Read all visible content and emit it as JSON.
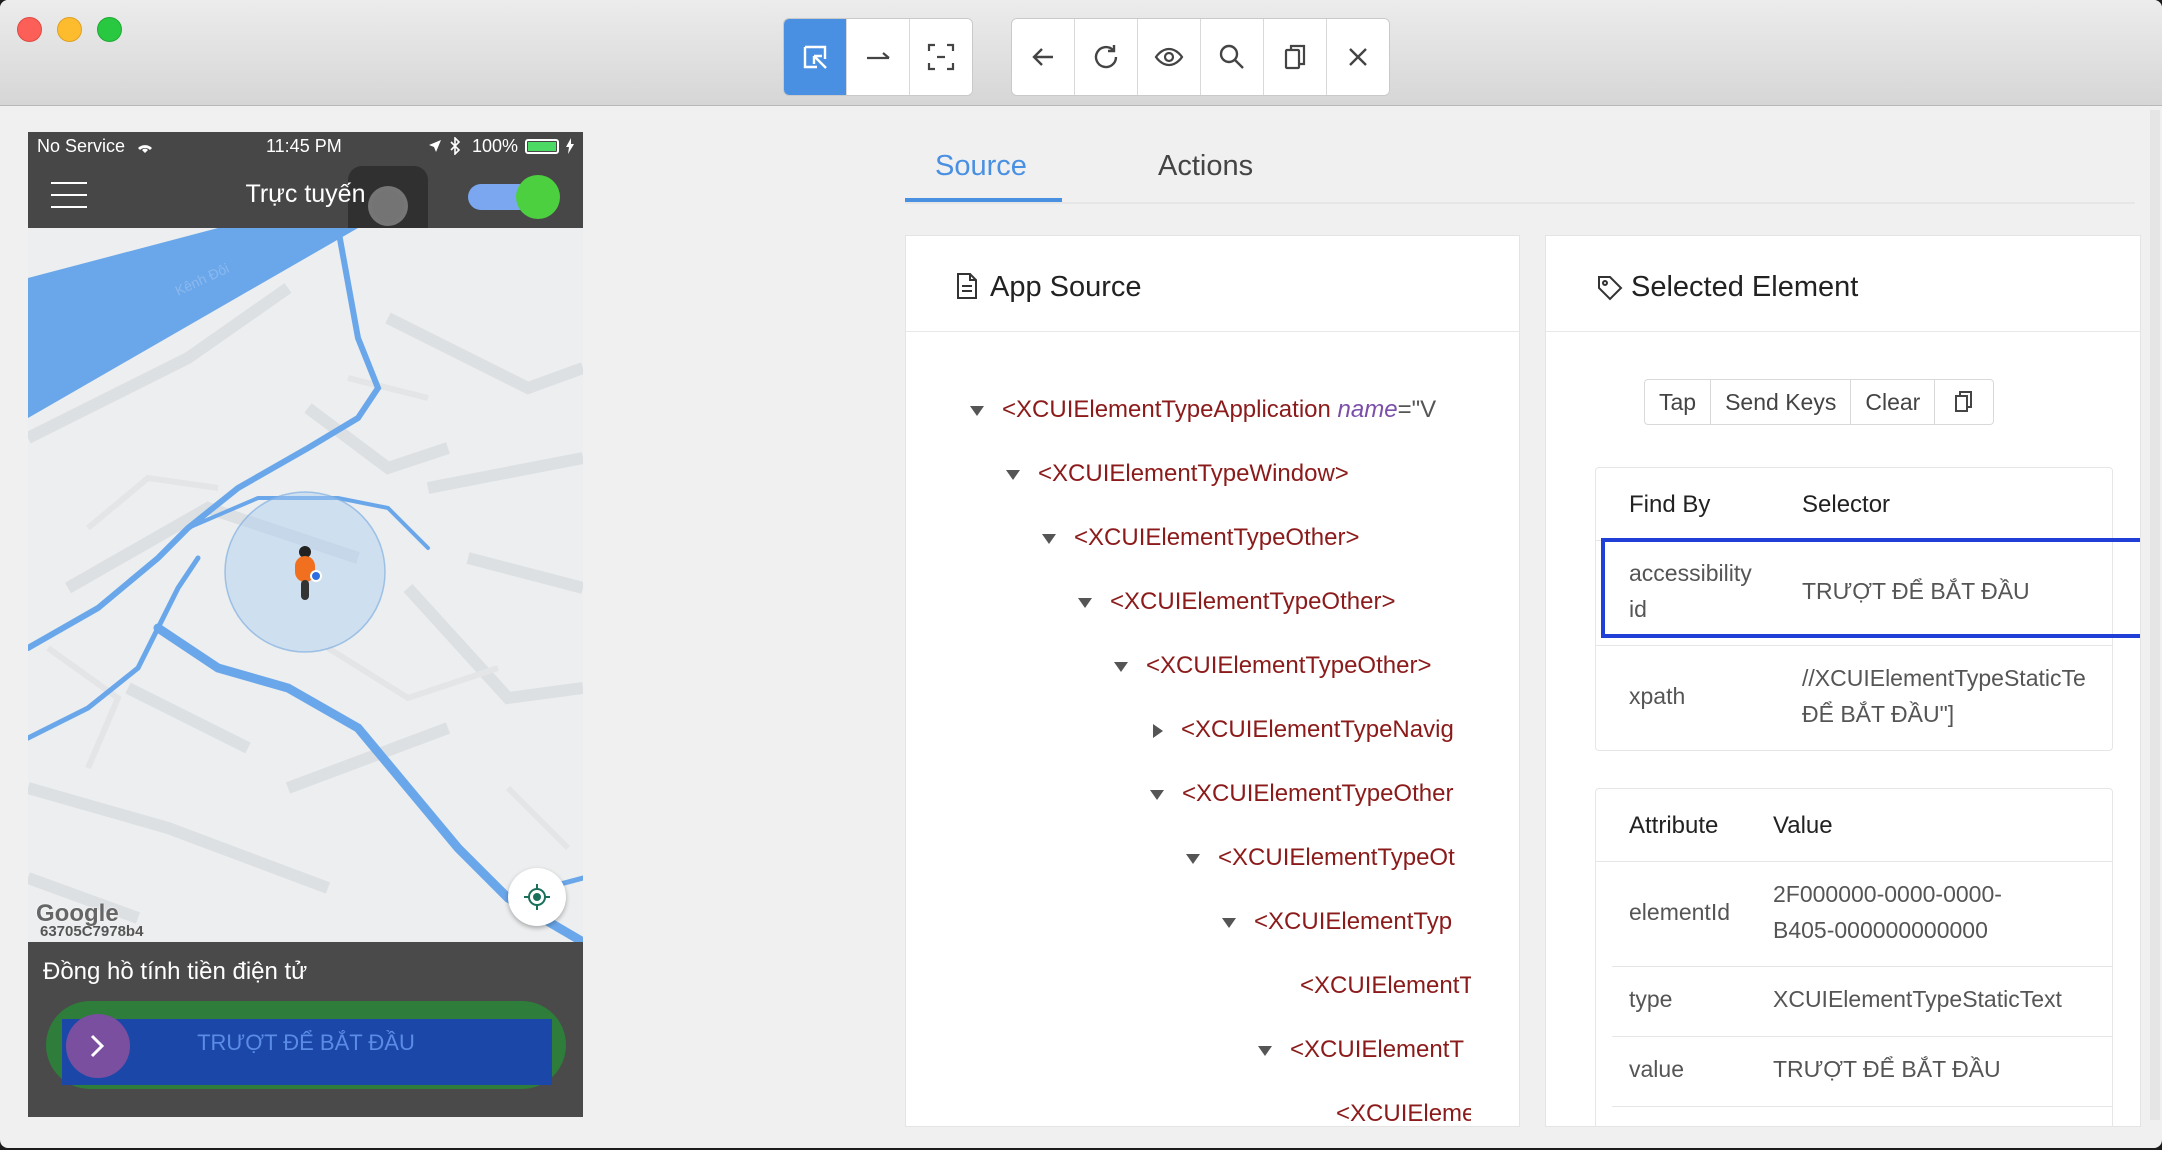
{
  "toolbar": {
    "icons": [
      "select-element-icon",
      "swipe-icon",
      "tap-coordinates-icon",
      "back-icon",
      "refresh-icon",
      "show-icon",
      "search-icon",
      "copy-icon",
      "close-icon"
    ]
  },
  "phone": {
    "status": {
      "carrier": "No Service",
      "time": "11:45 PM",
      "battery": "100%"
    },
    "nav_title": "Trực tuyến",
    "map_water_label": "Kênh Đôi",
    "google_label": "Google",
    "device_code": "63705C7978b4",
    "meter_label": "Đồng hồ tính tiền điện tử",
    "slide_label": "TRƯỢT ĐỂ BẮT ĐẦU"
  },
  "tabs": {
    "source": "Source",
    "actions": "Actions"
  },
  "app_source": {
    "title": "App Source",
    "nodes": [
      {
        "tag": "<XCUIElementTypeApplication",
        "attr": "name",
        "val": "=\"V"
      },
      {
        "tag": "<XCUIElementTypeWindow>"
      },
      {
        "tag": "<XCUIElementTypeOther>"
      },
      {
        "tag": "<XCUIElementTypeOther>"
      },
      {
        "tag": "<XCUIElementTypeOther>"
      },
      {
        "tag": "<XCUIElementTypeNavig"
      },
      {
        "tag": "<XCUIElementTypeOther"
      },
      {
        "tag": "<XCUIElementTypeOt"
      },
      {
        "tag": "<XCUIElementTyp"
      },
      {
        "tag": "<XCUIElementT"
      },
      {
        "tag": "<XCUIElementT"
      },
      {
        "tag": "<XCUIEleme"
      }
    ]
  },
  "selected": {
    "title": "Selected Element",
    "actions": [
      "Tap",
      "Send Keys",
      "Clear"
    ],
    "find_headers": [
      "Find By",
      "Selector"
    ],
    "find_rows": [
      {
        "by_1": "accessibility",
        "by_2": "id",
        "selector": "TRƯỢT ĐỂ BẮT ĐẦU"
      },
      {
        "by_1": "xpath",
        "by_2": "",
        "selector": "//XCUIElementTypeStaticTe",
        "selector_2": "ĐỂ BẮT ĐẦU\"]"
      }
    ],
    "attr_headers": [
      "Attribute",
      "Value"
    ],
    "attr_rows": [
      {
        "name": "elementId",
        "value": "2F000000-0000-0000-",
        "value_2": "B405-000000000000"
      },
      {
        "name": "type",
        "value": "XCUIElementTypeStaticText",
        "value_2": ""
      },
      {
        "name": "value",
        "value": "TRƯỢT ĐỂ BẮT ĐẦU",
        "value_2": ""
      }
    ]
  },
  "colors": {
    "accent": "#4a90e2",
    "tag": "#8b1a1a",
    "attr": "#7b4fa8",
    "highlight": "#1f3fd6"
  }
}
